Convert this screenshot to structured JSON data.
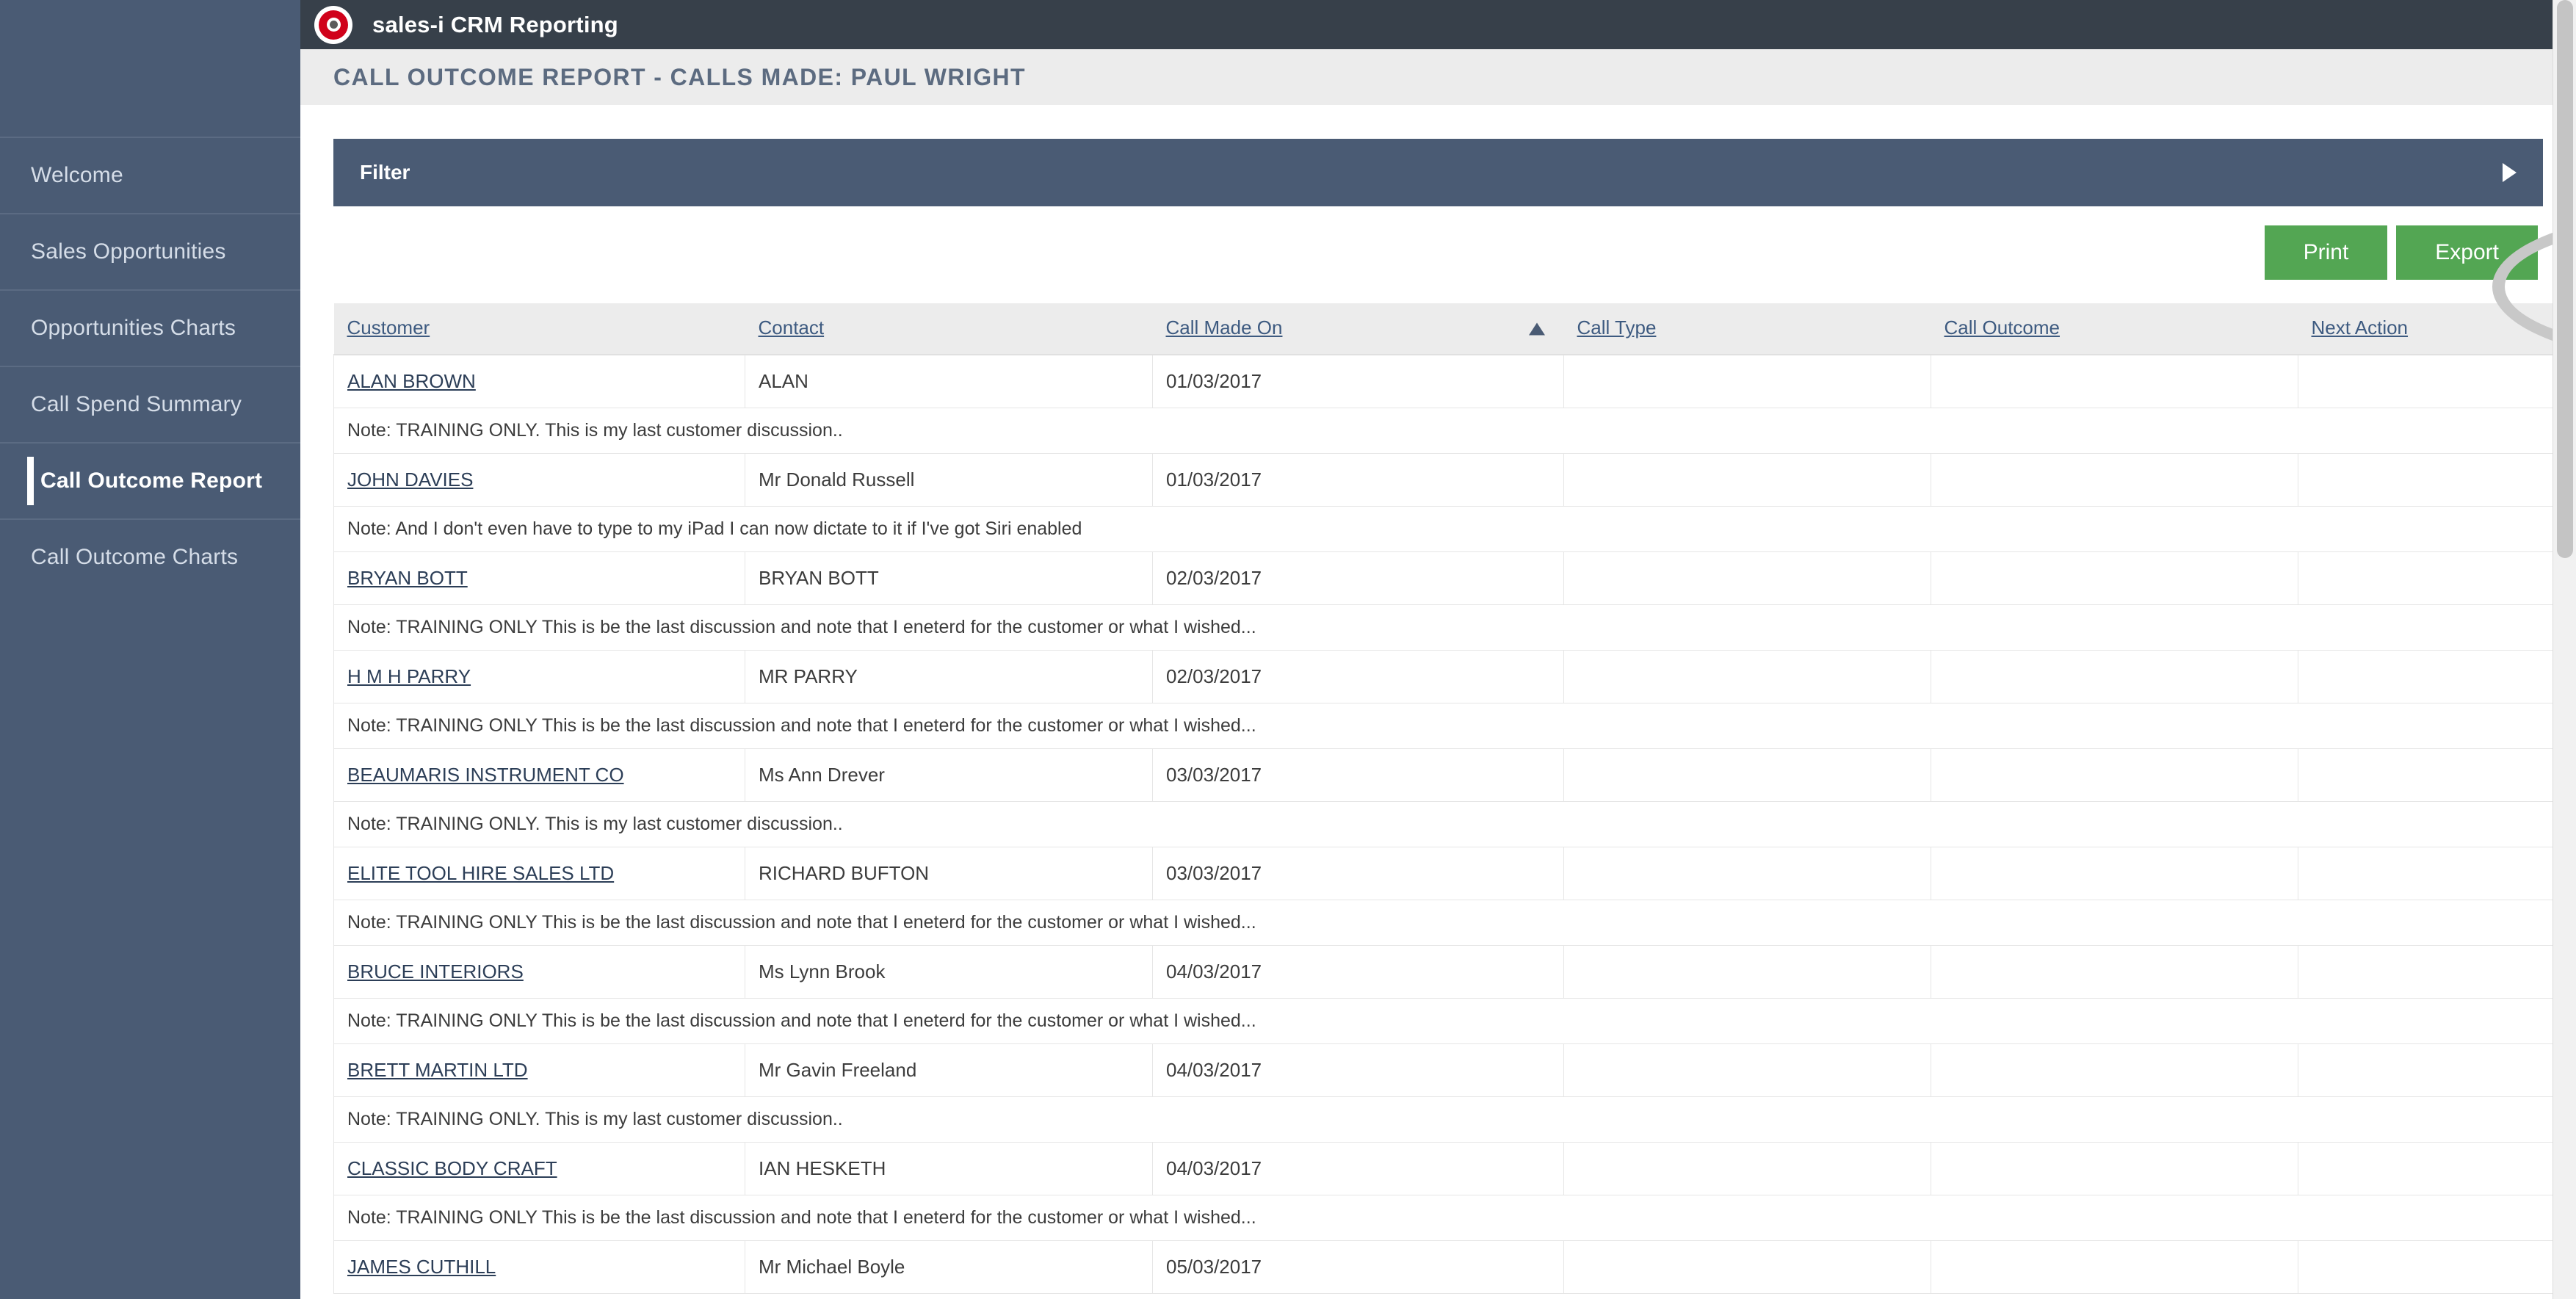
{
  "topbar": {
    "app_title": "sales-i CRM Reporting",
    "logo_icon": "sales-i-target-logo-icon",
    "brand_color": "#d0021b",
    "bar_color": "#37404a"
  },
  "sidebar": {
    "background_color": "#4a5b74",
    "items": [
      {
        "label": "Welcome",
        "active": false
      },
      {
        "label": "Sales Opportunities",
        "active": false
      },
      {
        "label": "Opportunities Charts",
        "active": false
      },
      {
        "label": "Call Spend Summary",
        "active": false
      },
      {
        "label": "Call Outcome Report",
        "active": true
      },
      {
        "label": "Call Outcome Charts",
        "active": false
      }
    ]
  },
  "page": {
    "title": "CALL OUTCOME REPORT - CALLS MADE: PAUL WRIGHT"
  },
  "filter": {
    "label": "Filter",
    "expand_icon": "play-right-triangle-icon",
    "bar_color": "#4a5b74"
  },
  "actions": {
    "print_label": "Print",
    "export_label": "Export",
    "button_color": "#53a653",
    "highlight_annotation": "gray-ellipse-highlight"
  },
  "table": {
    "columns": [
      "Customer",
      "Contact",
      "Call Made On",
      "Call Type",
      "Call Outcome",
      "Next Action"
    ],
    "sorted_column": "Call Made On",
    "sort_direction": "ascending",
    "sort_icon": "caret-up-icon",
    "rows": [
      {
        "customer": "ALAN BROWN",
        "contact": "ALAN",
        "call_made_on": "01/03/2017",
        "call_type": "",
        "call_outcome": "",
        "next_action": "",
        "note": "Note: TRAINING ONLY. This is my last customer discussion.."
      },
      {
        "customer": "JOHN DAVIES",
        "contact": "Mr Donald Russell",
        "call_made_on": "01/03/2017",
        "call_type": "",
        "call_outcome": "",
        "next_action": "",
        "note": "Note: And I don't even have to type to my iPad I can now dictate to it if I've got Siri enabled"
      },
      {
        "customer": "BRYAN BOTT",
        "contact": "BRYAN BOTT",
        "call_made_on": "02/03/2017",
        "call_type": "",
        "call_outcome": "",
        "next_action": "",
        "note": "Note: TRAINING ONLY This is be the last discussion and note that I eneterd for the customer or what I wished..."
      },
      {
        "customer": "H M H PARRY",
        "contact": "MR PARRY",
        "call_made_on": "02/03/2017",
        "call_type": "",
        "call_outcome": "",
        "next_action": "",
        "note": "Note: TRAINING ONLY This is be the last discussion and note that I eneterd for the customer or what I wished..."
      },
      {
        "customer": "BEAUMARIS INSTRUMENT CO",
        "contact": "Ms Ann Drever",
        "call_made_on": "03/03/2017",
        "call_type": "",
        "call_outcome": "",
        "next_action": "",
        "note": "Note: TRAINING ONLY. This is my last customer discussion.."
      },
      {
        "customer": "ELITE TOOL HIRE SALES LTD",
        "contact": "RICHARD BUFTON",
        "call_made_on": "03/03/2017",
        "call_type": "",
        "call_outcome": "",
        "next_action": "",
        "note": "Note: TRAINING ONLY This is be the last discussion and note that I eneterd for the customer or what I wished..."
      },
      {
        "customer": "BRUCE INTERIORS",
        "contact": "Ms Lynn Brook",
        "call_made_on": "04/03/2017",
        "call_type": "",
        "call_outcome": "",
        "next_action": "",
        "note": "Note: TRAINING ONLY This is be the last discussion and note that I eneterd for the customer or what I wished..."
      },
      {
        "customer": "BRETT MARTIN LTD",
        "contact": "Mr Gavin Freeland",
        "call_made_on": "04/03/2017",
        "call_type": "",
        "call_outcome": "",
        "next_action": "",
        "note": "Note: TRAINING ONLY. This is my last customer discussion.."
      },
      {
        "customer": "CLASSIC BODY CRAFT",
        "contact": "IAN HESKETH",
        "call_made_on": "04/03/2017",
        "call_type": "",
        "call_outcome": "",
        "next_action": "",
        "note": "Note: TRAINING ONLY This is be the last discussion and note that I eneterd for the customer or what I wished..."
      },
      {
        "customer": "JAMES CUTHILL",
        "contact": "Mr Michael Boyle",
        "call_made_on": "05/03/2017",
        "call_type": "",
        "call_outcome": "",
        "next_action": "",
        "note": null
      }
    ]
  },
  "scrollbar": {
    "orientation": "vertical",
    "position": "right"
  }
}
